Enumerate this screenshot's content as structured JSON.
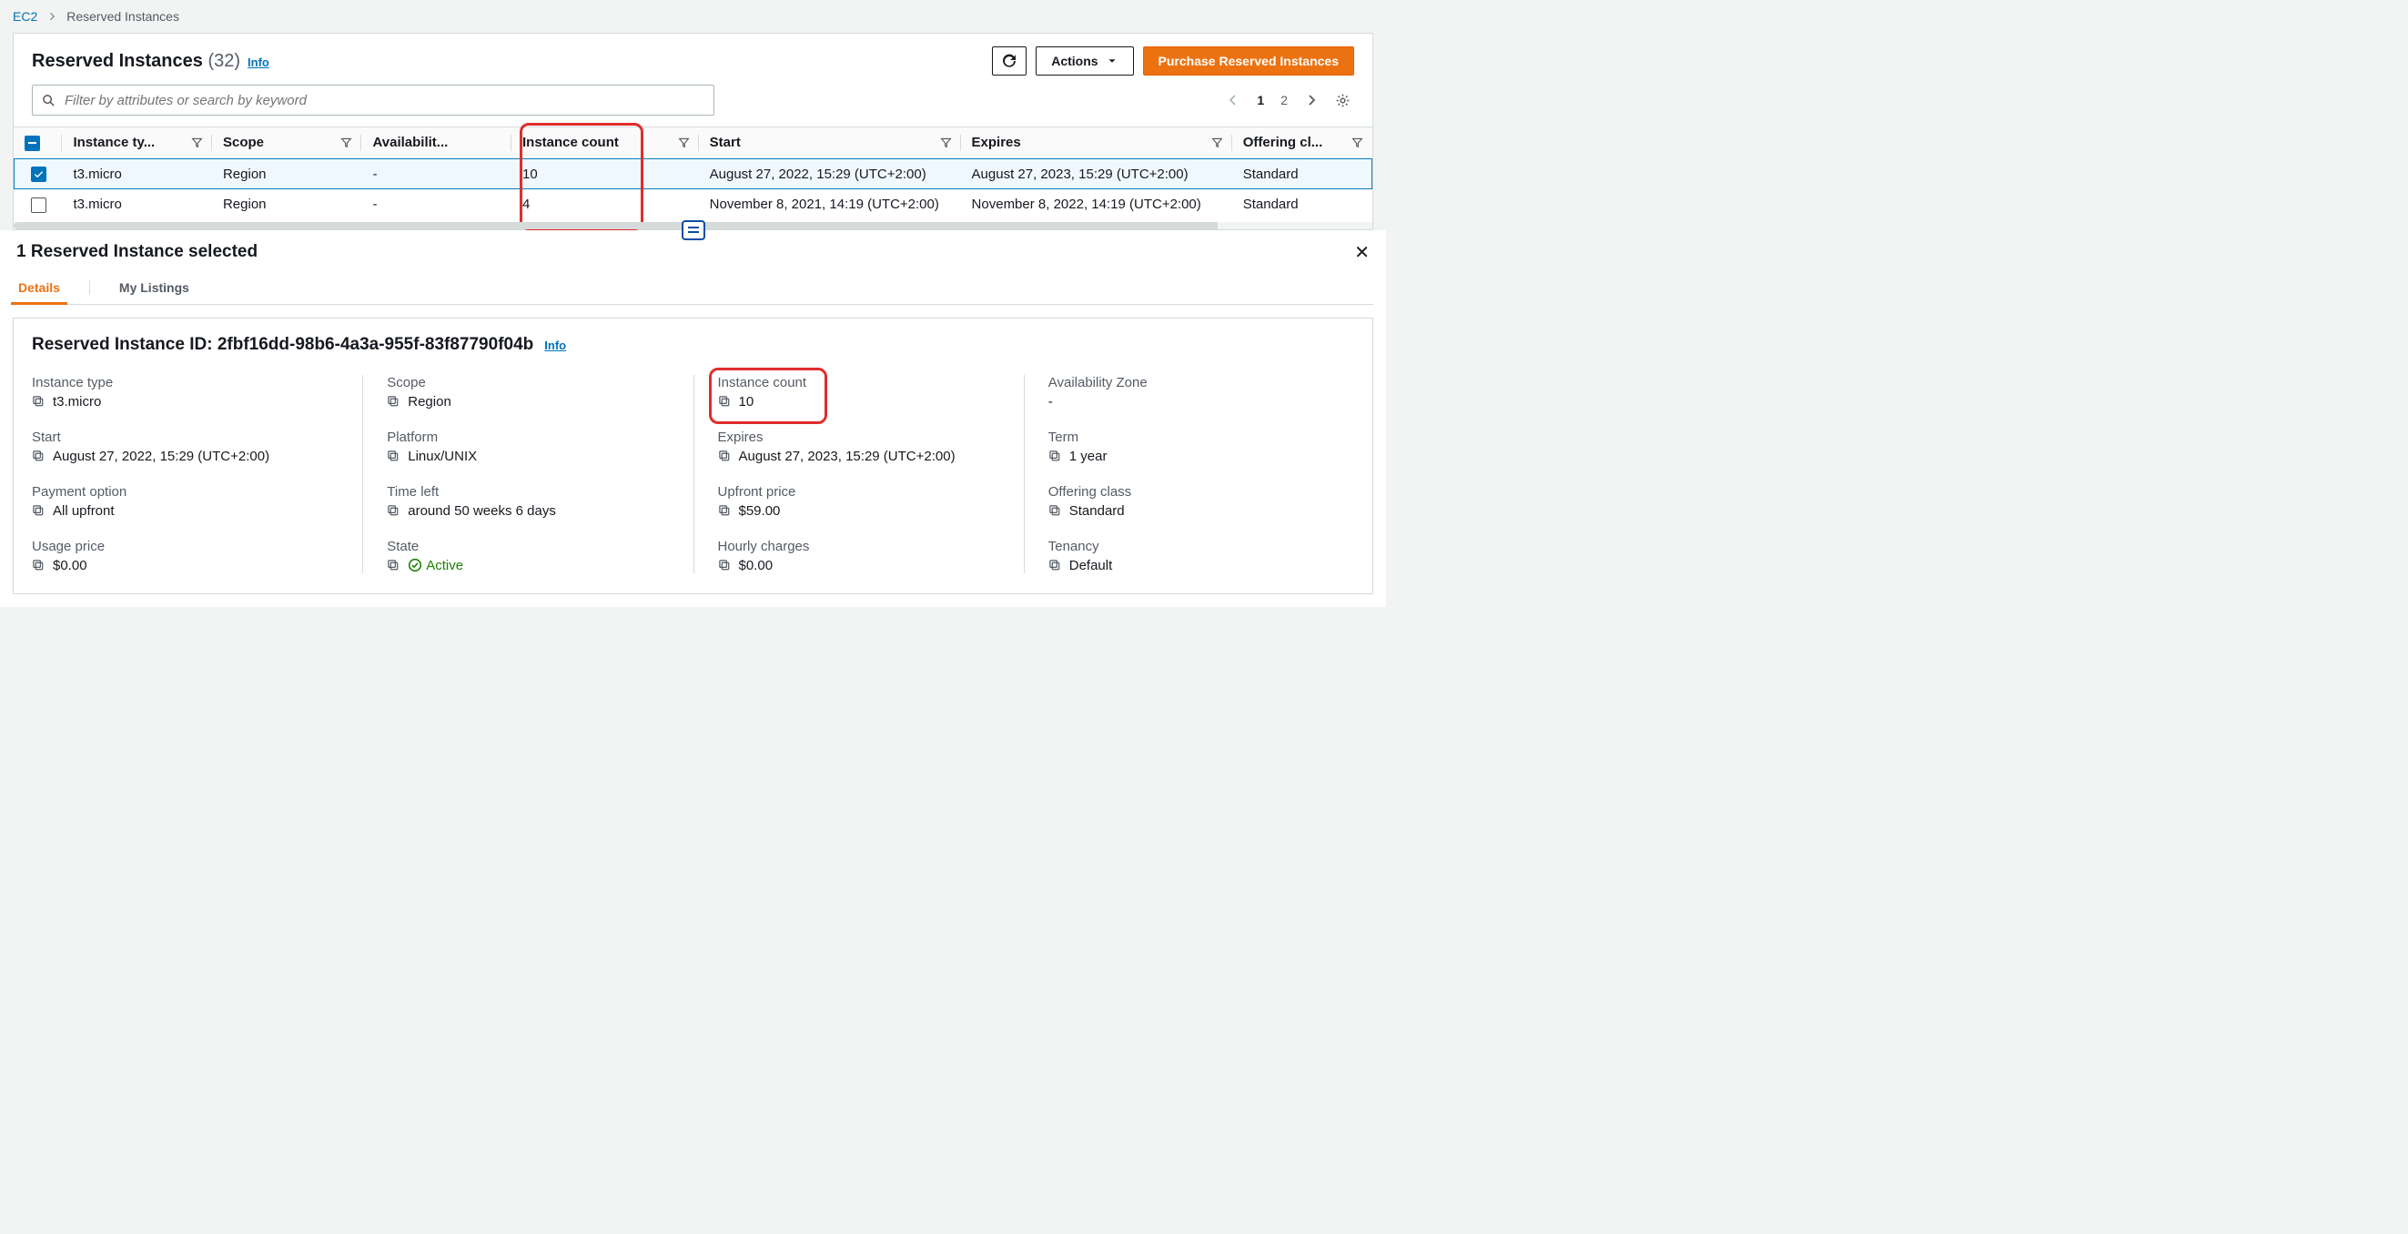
{
  "breadcrumb": {
    "root": "EC2",
    "current": "Reserved Instances"
  },
  "header": {
    "title": "Reserved Instances",
    "count": "(32)",
    "info": "Info",
    "actions_label": "Actions",
    "purchase_label": "Purchase Reserved Instances"
  },
  "filter": {
    "placeholder": "Filter by attributes or search by keyword"
  },
  "pager": {
    "page1": "1",
    "page2": "2"
  },
  "columns": {
    "instance_type": "Instance ty...",
    "scope": "Scope",
    "availability": "Availabilit...",
    "instance_count": "Instance count",
    "start": "Start",
    "expires": "Expires",
    "offering_class": "Offering cl..."
  },
  "rows": [
    {
      "selected": true,
      "instance_type": "t3.micro",
      "scope": "Region",
      "availability": "-",
      "instance_count": "10",
      "start": "August 27, 2022, 15:29 (UTC+2:00)",
      "expires": "August 27, 2023, 15:29 (UTC+2:00)",
      "offering_class": "Standard"
    },
    {
      "selected": false,
      "instance_type": "t3.micro",
      "scope": "Region",
      "availability": "-",
      "instance_count": "4",
      "start": "November 8, 2021, 14:19 (UTC+2:00)",
      "expires": "November 8, 2022, 14:19 (UTC+2:00)",
      "offering_class": "Standard"
    }
  ],
  "bottom": {
    "selection_title": "1 Reserved Instance selected",
    "tabs": {
      "details": "Details",
      "my_listings": "My Listings"
    },
    "detail_title_prefix": "Reserved Instance ID:",
    "detail_id": "2fbf16dd-98b6-4a3a-955f-83f87790f04b",
    "info": "Info",
    "fields": {
      "instance_type": {
        "label": "Instance type",
        "value": "t3.micro"
      },
      "scope": {
        "label": "Scope",
        "value": "Region"
      },
      "instance_count": {
        "label": "Instance count",
        "value": "10"
      },
      "availability_zone": {
        "label": "Availability Zone",
        "value": "-"
      },
      "start": {
        "label": "Start",
        "value": "August 27, 2022, 15:29 (UTC+2:00)"
      },
      "platform": {
        "label": "Platform",
        "value": "Linux/UNIX"
      },
      "expires": {
        "label": "Expires",
        "value": "August 27, 2023, 15:29 (UTC+2:00)"
      },
      "term": {
        "label": "Term",
        "value": "1 year"
      },
      "payment_option": {
        "label": "Payment option",
        "value": "All upfront"
      },
      "time_left": {
        "label": "Time left",
        "value": "around 50 weeks 6 days"
      },
      "upfront_price": {
        "label": "Upfront price",
        "value": "$59.00"
      },
      "offering_class": {
        "label": "Offering class",
        "value": "Standard"
      },
      "usage_price": {
        "label": "Usage price",
        "value": "$0.00"
      },
      "state": {
        "label": "State",
        "value": "Active"
      },
      "hourly_charges": {
        "label": "Hourly charges",
        "value": "$0.00"
      },
      "tenancy": {
        "label": "Tenancy",
        "value": "Default"
      }
    }
  }
}
